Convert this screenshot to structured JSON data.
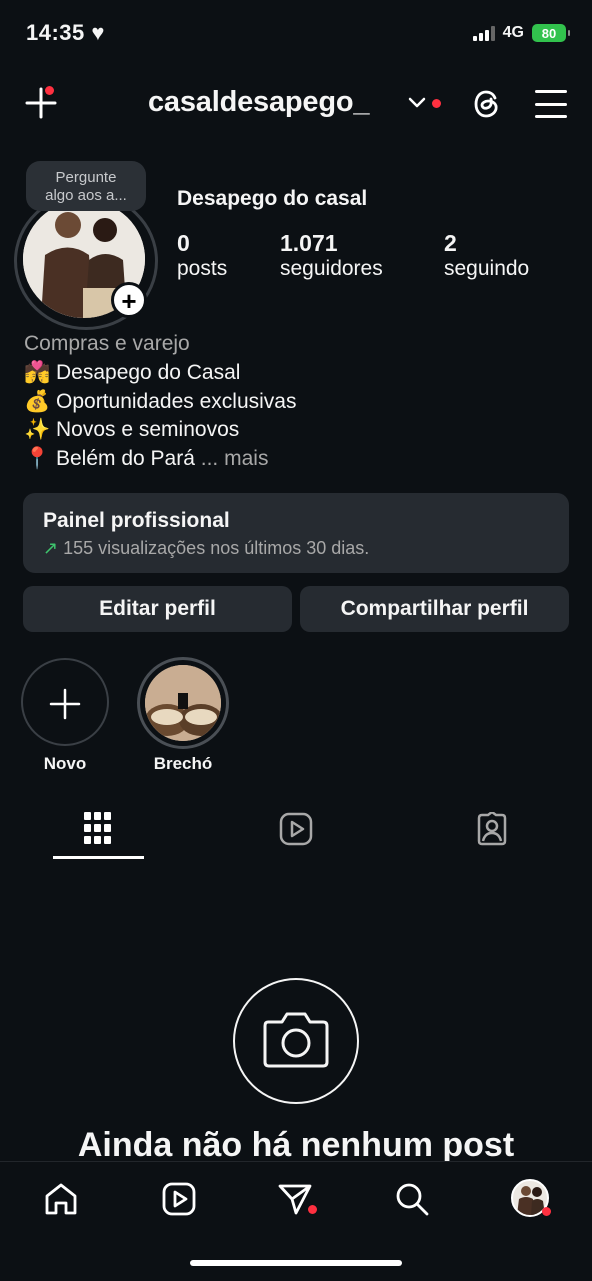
{
  "status_bar": {
    "time": "14:35",
    "network": "4G",
    "battery": "80"
  },
  "header": {
    "username": "casaldesapego_"
  },
  "profile": {
    "bubble_text_1": "Pergunte",
    "bubble_text_2": "algo aos a...",
    "display_name": "Desapego do casal",
    "stats": [
      {
        "value": "0",
        "label": "posts"
      },
      {
        "value": "1.071",
        "label": "seguidores"
      },
      {
        "value": "2",
        "label": "seguindo"
      }
    ],
    "category": "Compras e varejo",
    "bio": [
      {
        "emoji": "💏",
        "text": "Desapego do Casal"
      },
      {
        "emoji": "💰",
        "text": "Oportunidades exclusivas"
      },
      {
        "emoji": "✨",
        "text": "Novos e seminovos"
      },
      {
        "emoji": "📍",
        "text": "Belém do Pará"
      }
    ],
    "bio_more": "... mais"
  },
  "panel": {
    "title": "Painel profissional",
    "arrow": "↗",
    "subtitle": "155 visualizações nos últimos 30 dias."
  },
  "buttons": {
    "edit": "Editar perfil",
    "share": "Compartilhar perfil"
  },
  "highlights": [
    {
      "label": "Novo"
    },
    {
      "label": "Brechó"
    }
  ],
  "empty_state": {
    "title": "Ainda não há nenhum post"
  },
  "colors": {
    "background": "#0c1014",
    "surface": "#262b31",
    "notification": "#ff3040",
    "trend": "#3ec46d"
  }
}
